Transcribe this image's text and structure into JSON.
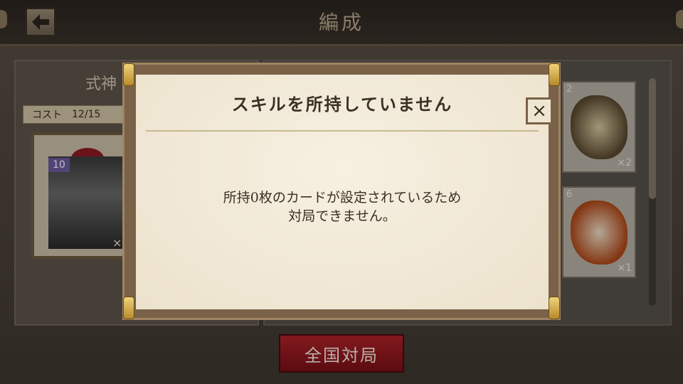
{
  "header": {
    "title": "編成",
    "back_icon": "back-arrow-icon"
  },
  "left_panel": {
    "title": "式神",
    "cost_label": "コスト",
    "cost_value": "12/15",
    "card_level": "10",
    "card_count": "×0"
  },
  "right_panel": {
    "cards": [
      {
        "number": "2",
        "count": "×2"
      },
      {
        "number": "6",
        "count": "×1"
      }
    ]
  },
  "dialog": {
    "title": "スキルを所持していません",
    "message_line1": "所持0枚のカードが設定されているため",
    "message_line2": "対局できません。",
    "close_label": "×"
  },
  "bottom": {
    "battle_button": "全国対局"
  },
  "colors": {
    "paper": "#f4ecdc",
    "frame": "#7a6248",
    "accent_red": "#a01c24",
    "gold": "#d8b04a"
  }
}
